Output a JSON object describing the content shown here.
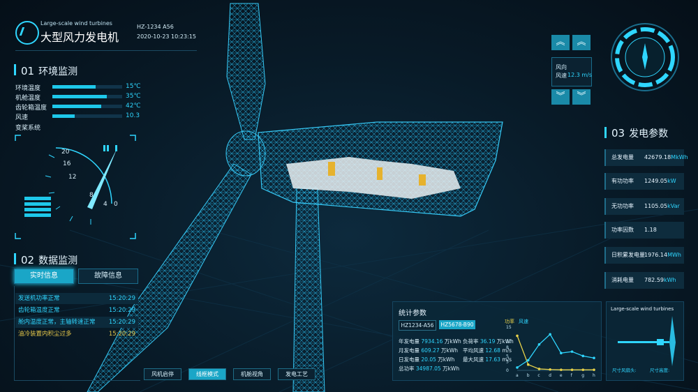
{
  "header": {
    "subtitle_en": "Large-scale wind turbines",
    "title": "大型风力发电机",
    "device_id": "HZ-1234 A56",
    "datetime": "2020-10-23 10:23:15"
  },
  "env_panel": {
    "num": "01",
    "title": "环境监测",
    "rows": [
      {
        "label": "环境温度",
        "value": "15℃",
        "fill": 0.62
      },
      {
        "label": "机舱温度",
        "value": "35℃",
        "fill": 0.78
      },
      {
        "label": "齿轮箱温度",
        "value": "42℃",
        "fill": 0.7
      },
      {
        "label": "风速",
        "value": "10.3",
        "fill": 0.32
      }
    ],
    "pitch_label": "变桨系统",
    "gauge_ticks": [
      "20",
      "16",
      "12",
      "8",
      "4",
      "0"
    ]
  },
  "data_panel": {
    "num": "02",
    "title": "数据监测",
    "tabs": [
      "实时信息",
      "故障信息"
    ],
    "messages": [
      {
        "text": "发送机功率正常",
        "time": "15:20:29",
        "warn": false
      },
      {
        "text": "齿轮箱温度正常",
        "time": "15:20:29",
        "warn": false
      },
      {
        "text": "舱内温度正常，主轴转速正常",
        "time": "15:20:29",
        "warn": false
      },
      {
        "text": "油冷装置内积尘过多",
        "time": "15:20:29",
        "warn": true
      }
    ]
  },
  "wind": {
    "dir_label": "风向",
    "speed_label": "风速",
    "speed_value": "12.3 m/s"
  },
  "power_panel": {
    "num": "03",
    "title": "发电参数",
    "params": [
      {
        "label": "总发电量",
        "value": "42679.18",
        "unit": "MkWh"
      },
      {
        "label": "有功功率",
        "value": "1249.05",
        "unit": "kW"
      },
      {
        "label": "无功功率",
        "value": "1105.05",
        "unit": "kVar"
      },
      {
        "label": "功率因数",
        "value": "1.18",
        "unit": ""
      },
      {
        "label": "日积累发电量",
        "value": "1976.14",
        "unit": "MWh"
      },
      {
        "label": "消耗电量",
        "value": "782.59",
        "unit": "kWh"
      }
    ]
  },
  "bottom_tabs": [
    "风机启停",
    "线框模式",
    "机舱视角",
    "发电工艺"
  ],
  "stats": {
    "title": "统计参数",
    "tabs": [
      "HZ1234-A56",
      "HZ5678-B90"
    ],
    "rows": [
      [
        {
          "k": "年发电量",
          "v": "7934.16",
          "u": "万kWh"
        },
        {
          "k": "负荷率",
          "v": "36.19",
          "u": "万kWh"
        }
      ],
      [
        {
          "k": "月发电量",
          "v": "609.27",
          "u": "万kWh"
        },
        {
          "k": "平均风速",
          "v": "12.68",
          "u": "m/s"
        }
      ],
      [
        {
          "k": "日发电量",
          "v": "20.05",
          "u": "万kWh"
        },
        {
          "k": "最大风速",
          "v": "17.63",
          "u": "m/s"
        }
      ],
      [
        {
          "k": "总功率",
          "v": "34987.05",
          "u": "万kWh"
        }
      ]
    ]
  },
  "chart_data": {
    "type": "line",
    "categories": [
      "a",
      "b",
      "c",
      "d",
      "e",
      "f",
      "g",
      "h"
    ],
    "series": [
      {
        "name": "功率",
        "values": [
          12,
          2,
          0.5,
          0.3,
          0.2,
          0.2,
          0.2,
          0.2
        ],
        "color": "#e8d24a"
      },
      {
        "name": "风速",
        "values": [
          1,
          3.5,
          9,
          12.5,
          6,
          6.5,
          5,
          4.3
        ],
        "color": "#2fd6ff"
      }
    ],
    "yticks": [
      "0",
      "3",
      "5",
      "8",
      "10",
      "15"
    ],
    "ylim": [
      0,
      15
    ]
  },
  "mini_panel": {
    "title": "Large-scale wind turbines",
    "left_label": "尺寸风扇头:",
    "right_label": "尺寸高度:"
  },
  "colors": {
    "accent": "#2fd6ff",
    "warn": "#e6c84a",
    "bg": "#081a27"
  }
}
